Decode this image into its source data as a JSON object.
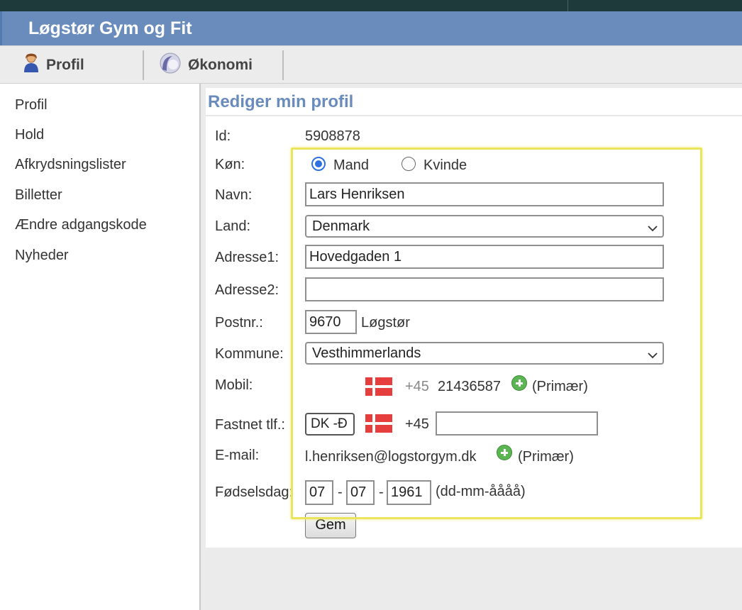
{
  "app": {
    "title": "Løgstør Gym og Fit"
  },
  "nav": {
    "tabs": [
      {
        "label": "Profil",
        "icon": "user-icon"
      },
      {
        "label": "Økonomi",
        "icon": "economy-icon"
      }
    ]
  },
  "sidebar": {
    "items": [
      {
        "label": "Profil"
      },
      {
        "label": "Hold"
      },
      {
        "label": "Afkrydsningslister"
      },
      {
        "label": "Billetter"
      },
      {
        "label": "Ændre adgangskode"
      },
      {
        "label": "Nyheder"
      }
    ]
  },
  "form": {
    "title": "Rediger min profil",
    "id_label": "Id:",
    "id_value": "5908878",
    "gender_label": "Køn:",
    "gender_options": [
      "Mand",
      "Kvinde"
    ],
    "gender_selected": "Mand",
    "name_label": "Navn:",
    "name_value": "Lars Henriksen",
    "country_label": "Land:",
    "country_value": "Denmark",
    "address1_label": "Adresse1:",
    "address1_value": "Hovedgaden 1",
    "address2_label": "Adresse2:",
    "address2_value": "",
    "postal_label": "Postnr.:",
    "postal_value": "9670",
    "city_value": "Løgstør",
    "municipality_label": "Kommune:",
    "municipality_value": "Vesthimmerlands",
    "mobile_label": "Mobil:",
    "mobile_prefix": "+45",
    "mobile_number": "21436587",
    "primary_text": "(Primær)",
    "landline_label": "Fastnet tlf.:",
    "landline_country": "DK -Đ",
    "landline_prefix": "+45",
    "landline_value": "",
    "email_label": "E-mail:",
    "email_value": "l.henriksen@logstorgym.dk",
    "birthday_label": "Fødselsdag:",
    "birth_day": "07",
    "birth_month": "07",
    "birth_year": "1961",
    "date_sep": "-",
    "date_format": "(dd-mm-åååå)",
    "save_label": "Gem"
  },
  "colors": {
    "brand_bar": "#6a8cbd",
    "top_strip": "#1f3a3b",
    "title": "#6a8cbd",
    "highlight": "#eae55a",
    "radio_accent": "#2f6fe0",
    "flag_red": "#e63d3d",
    "add_green": "#5bb552"
  }
}
